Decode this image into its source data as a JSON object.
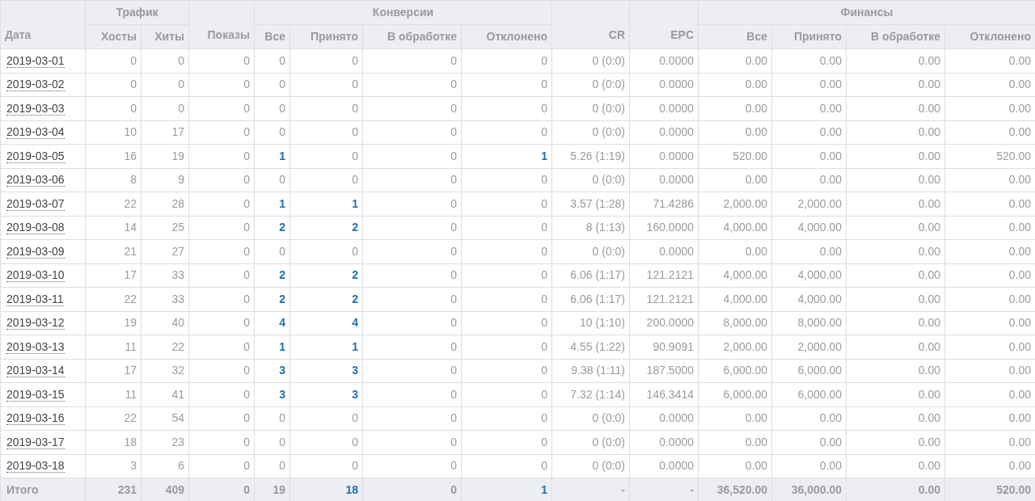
{
  "table": {
    "header": [
      {
        "label": "Дата"
      },
      {
        "label": "Трафик",
        "children": [
          {
            "label": "Хосты"
          },
          {
            "label": "Хиты"
          }
        ]
      },
      {
        "label": "Показы"
      },
      {
        "label": "Конверсии",
        "children": [
          {
            "label": "Все"
          },
          {
            "label": "Принято"
          },
          {
            "label": "В обработке"
          },
          {
            "label": "Отклонено"
          }
        ]
      },
      {
        "label": "CR"
      },
      {
        "label": "EPC"
      },
      {
        "label": "Финансы",
        "children": [
          {
            "label": "Все"
          },
          {
            "label": "Принято"
          },
          {
            "label": "В обработке"
          },
          {
            "label": "Отклонено"
          }
        ]
      }
    ],
    "rows": [
      {
        "cells": [
          "2019-03-01",
          "0",
          "0",
          "0",
          "0",
          "0",
          "0",
          "0",
          "0 (0:0)",
          "0.0000",
          "0.00",
          "0.00",
          "0.00",
          "0.00"
        ]
      },
      {
        "cells": [
          "2019-03-02",
          "0",
          "0",
          "0",
          "0",
          "0",
          "0",
          "0",
          "0 (0:0)",
          "0.0000",
          "0.00",
          "0.00",
          "0.00",
          "0.00"
        ]
      },
      {
        "cells": [
          "2019-03-03",
          "0",
          "0",
          "0",
          "0",
          "0",
          "0",
          "0",
          "0 (0:0)",
          "0.0000",
          "0.00",
          "0.00",
          "0.00",
          "0.00"
        ]
      },
      {
        "cells": [
          "2019-03-04",
          "10",
          "17",
          "0",
          "0",
          "0",
          "0",
          "0",
          "0 (0:0)",
          "0.0000",
          "0.00",
          "0.00",
          "0.00",
          "0.00"
        ]
      },
      {
        "cells": [
          "2019-03-05",
          "16",
          "19",
          "0",
          {
            "text": "1",
            "link": true
          },
          "0",
          "0",
          {
            "text": "1",
            "link": true
          },
          "5.26 (1:19)",
          "0.0000",
          "520.00",
          "0.00",
          "0.00",
          "520.00"
        ]
      },
      {
        "cells": [
          "2019-03-06",
          "8",
          "9",
          "0",
          "0",
          "0",
          "0",
          "0",
          "0 (0:0)",
          "0.0000",
          "0.00",
          "0.00",
          "0.00",
          "0.00"
        ]
      },
      {
        "cells": [
          "2019-03-07",
          "22",
          "28",
          "0",
          {
            "text": "1",
            "link": true
          },
          {
            "text": "1",
            "link": true
          },
          "0",
          "0",
          "3.57 (1:28)",
          "71.4286",
          "2,000.00",
          "2,000.00",
          "0.00",
          "0.00"
        ]
      },
      {
        "cells": [
          "2019-03-08",
          "14",
          "25",
          "0",
          {
            "text": "2",
            "link": true
          },
          {
            "text": "2",
            "link": true
          },
          "0",
          "0",
          "8 (1:13)",
          "160.0000",
          "4,000.00",
          "4,000.00",
          "0.00",
          "0.00"
        ]
      },
      {
        "cells": [
          "2019-03-09",
          "21",
          "27",
          "0",
          "0",
          "0",
          "0",
          "0",
          "0 (0:0)",
          "0.0000",
          "0.00",
          "0.00",
          "0.00",
          "0.00"
        ]
      },
      {
        "cells": [
          "2019-03-10",
          "17",
          "33",
          "0",
          {
            "text": "2",
            "link": true
          },
          {
            "text": "2",
            "link": true
          },
          "0",
          "0",
          "6.06 (1:17)",
          "121.2121",
          "4,000.00",
          "4,000.00",
          "0.00",
          "0.00"
        ]
      },
      {
        "cells": [
          "2019-03-11",
          "22",
          "33",
          "0",
          {
            "text": "2",
            "link": true
          },
          {
            "text": "2",
            "link": true
          },
          "0",
          "0",
          "6.06 (1:17)",
          "121.2121",
          "4,000.00",
          "4,000.00",
          "0.00",
          "0.00"
        ]
      },
      {
        "cells": [
          "2019-03-12",
          "19",
          "40",
          "0",
          {
            "text": "4",
            "link": true
          },
          {
            "text": "4",
            "link": true
          },
          "0",
          "0",
          "10 (1:10)",
          "200.0000",
          "8,000.00",
          "8,000.00",
          "0.00",
          "0.00"
        ]
      },
      {
        "cells": [
          "2019-03-13",
          "11",
          "22",
          "0",
          {
            "text": "1",
            "link": true
          },
          {
            "text": "1",
            "link": true
          },
          "0",
          "0",
          "4.55 (1:22)",
          "90.9091",
          "2,000.00",
          "2,000.00",
          "0.00",
          "0.00"
        ]
      },
      {
        "cells": [
          "2019-03-14",
          "17",
          "32",
          "0",
          {
            "text": "3",
            "link": true
          },
          {
            "text": "3",
            "link": true
          },
          "0",
          "0",
          "9.38 (1:11)",
          "187.5000",
          "6,000.00",
          "6,000.00",
          "0.00",
          "0.00"
        ]
      },
      {
        "cells": [
          "2019-03-15",
          "11",
          "41",
          "0",
          {
            "text": "3",
            "link": true
          },
          {
            "text": "3",
            "link": true
          },
          "0",
          "0",
          "7.32 (1:14)",
          "146.3414",
          "6,000.00",
          "6,000.00",
          "0.00",
          "0.00"
        ]
      },
      {
        "cells": [
          "2019-03-16",
          "22",
          "54",
          "0",
          "0",
          "0",
          "0",
          "0",
          "0 (0:0)",
          "0.0000",
          "0.00",
          "0.00",
          "0.00",
          "0.00"
        ]
      },
      {
        "cells": [
          "2019-03-17",
          "18",
          "23",
          "0",
          "0",
          "0",
          "0",
          "0",
          "0 (0:0)",
          "0.0000",
          "0.00",
          "0.00",
          "0.00",
          "0.00"
        ]
      },
      {
        "cells": [
          "2019-03-18",
          "3",
          "6",
          "0",
          "0",
          "0",
          "0",
          "0",
          "0 (0:0)",
          "0.0000",
          "0.00",
          "0.00",
          "0.00",
          "0.00"
        ]
      }
    ],
    "total": {
      "cells": [
        "Итого",
        "231",
        "409",
        "0",
        "19",
        {
          "text": "18",
          "link": true
        },
        "0",
        {
          "text": "1",
          "link": true
        },
        "-",
        "-",
        "36,520.00",
        "36,000.00",
        "0.00",
        "520.00"
      ]
    }
  }
}
